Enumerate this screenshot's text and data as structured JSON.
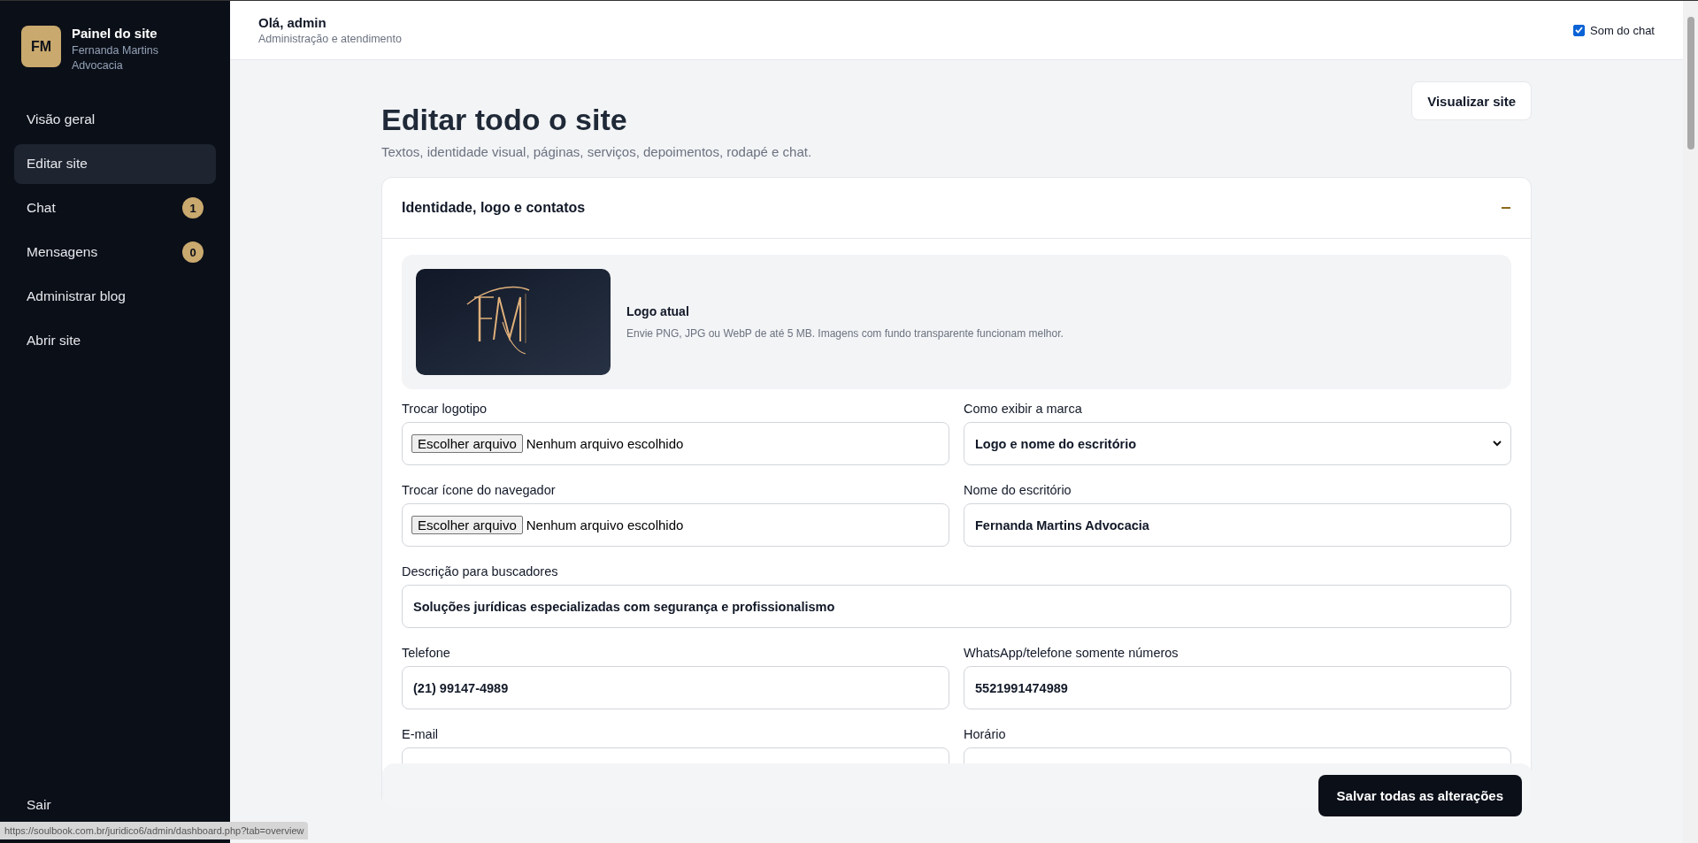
{
  "sidebar": {
    "brand": {
      "initials": "FM",
      "title": "Painel do site",
      "subtitle": "Fernanda Martins Advocacia"
    },
    "items": [
      {
        "label": "Visão geral",
        "selected": false
      },
      {
        "label": "Editar site",
        "selected": true
      },
      {
        "label": "Chat",
        "badge": "1",
        "selected": false
      },
      {
        "label": "Mensagens",
        "badge": "0",
        "selected": false
      },
      {
        "label": "Administrar blog",
        "selected": false
      },
      {
        "label": "Abrir site",
        "selected": false
      }
    ],
    "logout": "Sair"
  },
  "header": {
    "greeting": "Olá, admin",
    "subtitle": "Administração e atendimento",
    "sound_toggle": {
      "label": "Som do chat",
      "checked": true
    }
  },
  "page": {
    "title": "Editar todo o site",
    "subtitle": "Textos, identidade visual, páginas, serviços, depoimentos, rodapé e chat.",
    "view_button": "Visualizar site"
  },
  "section": {
    "title": "Identidade, logo e contatos",
    "expanded": true,
    "logo_panel": {
      "title": "Logo atual",
      "hint": "Envie PNG, JPG ou WebP de até 5 MB. Imagens com fundo transparente funcionam melhor."
    },
    "fields": [
      {
        "kind": "file",
        "label": "Trocar logotipo",
        "button": "Escolher arquivo",
        "value": "Nenhum arquivo escolhido"
      },
      {
        "kind": "select",
        "label": "Como exibir a marca",
        "value": "Logo e nome do escritório"
      },
      {
        "kind": "file",
        "label": "Trocar ícone do navegador",
        "button": "Escolher arquivo",
        "value": "Nenhum arquivo escolhido"
      },
      {
        "kind": "text",
        "label": "Nome do escritório",
        "value": "Fernanda Martins Advocacia"
      },
      {
        "kind": "text",
        "label": "Descrição para buscadores",
        "value": "Soluções jurídicas especializadas com segurança e profissionalismo",
        "wide": true
      },
      {
        "kind": "text",
        "label": "Telefone",
        "value": "(21) 99147-4989"
      },
      {
        "kind": "text",
        "label": "WhatsApp/telefone somente números",
        "value": "5521991474989"
      },
      {
        "kind": "text",
        "label": "E-mail"
      },
      {
        "kind": "text",
        "label": "Horário"
      }
    ]
  },
  "save_bar": {
    "button": "Salvar todas as alterações"
  },
  "status_url": "https://soulbook.com.br/juridico6/admin/dashboard.php?tab=overview"
}
